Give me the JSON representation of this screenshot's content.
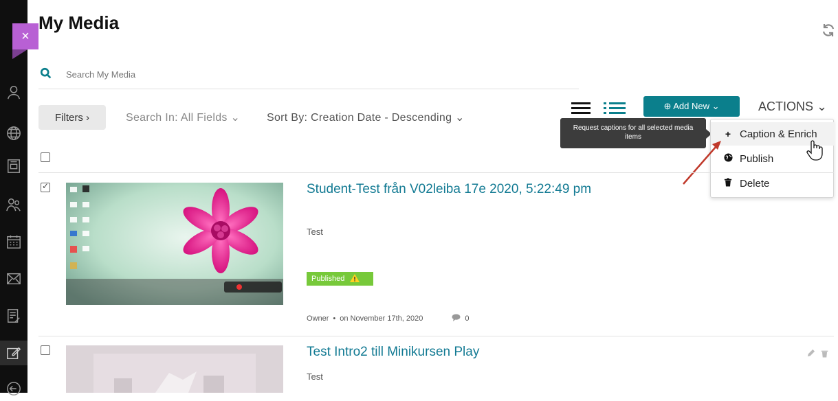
{
  "sidebar": {
    "icons": [
      "user-icon",
      "globe-icon",
      "layout-icon",
      "people-icon",
      "calendar-icon",
      "mail-icon",
      "notes-icon",
      "edit-icon",
      "logout-icon"
    ]
  },
  "close_label": "×",
  "page": {
    "title": "My Media"
  },
  "search": {
    "placeholder": "Search My Media"
  },
  "toolbar": {
    "filters_label": "Filters ›",
    "search_in": "Search In: All Fields ⌄",
    "sort_by": "Sort By: Creation Date - Descending ⌄",
    "add_new_label": "⊕ Add New ⌄",
    "actions_label": "ACTIONS ⌄"
  },
  "tooltip": {
    "text": "Request captions for all selected media items"
  },
  "actions_menu": {
    "items": [
      {
        "label": "Caption & Enrich",
        "icon": "plus-icon"
      },
      {
        "label": "Publish",
        "icon": "globe-icon"
      },
      {
        "label": "Delete",
        "icon": "trash-icon"
      }
    ]
  },
  "media": [
    {
      "title": "Student-Test från V02leiba 17e 2020, 5:22:49 pm",
      "description": "Test",
      "status": "Published",
      "status_icon": "warning-icon",
      "owner": "Owner",
      "date": "on November 17th, 2020",
      "comments": "0",
      "checked": true
    },
    {
      "title": "Test Intro2 till Minikursen Play",
      "description": "Test",
      "checked": false
    }
  ],
  "colors": {
    "accent": "#0b7f8c",
    "title_link": "#127a93",
    "published": "#77c93a",
    "close_tab": "#b860d4"
  }
}
